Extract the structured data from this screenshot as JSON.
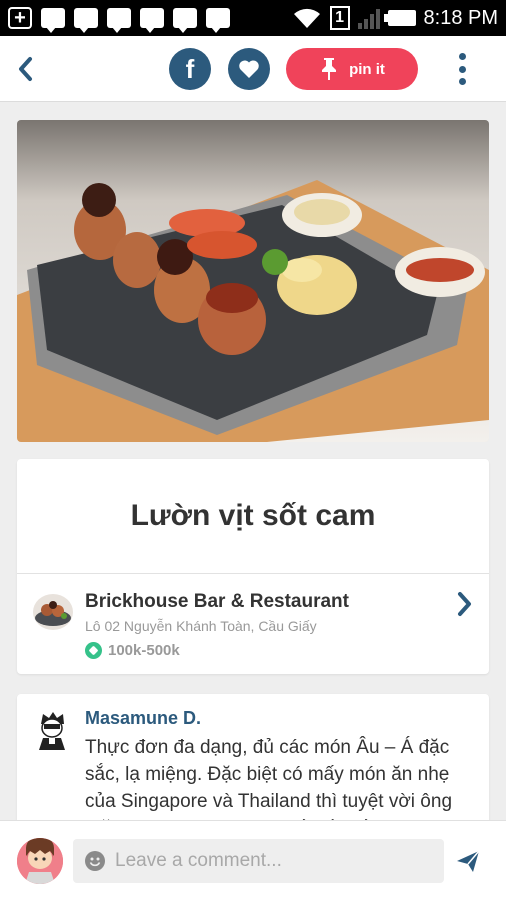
{
  "status_bar": {
    "time": "8:18 PM",
    "sim_label": "1"
  },
  "toolbar": {
    "pin_label": "pin it",
    "facebook_letter": "f"
  },
  "dish": {
    "name": "Lườn vịt sốt cam"
  },
  "venue": {
    "name": "Brickhouse Bar & Restaurant",
    "address": "Lô 02 Nguyễn Khánh Toàn, Cầu Giấy",
    "price_range": "100k-500k"
  },
  "review": {
    "author": "Masamune D.",
    "text": "Thực đơn đa dạng, đủ các món Âu – Á đặc sắc, lạ miệng. Đặc biệt có mấy món ăn nhẹ của Singapore và Thailand thì tuyệt vời ông mặt trời luôn! Ngó qua thấy đồ uống cũng"
  },
  "comment": {
    "placeholder": "Leave a comment..."
  },
  "colors": {
    "primary": "#2c5a7d",
    "pin": "#f0435a",
    "price_badge": "#35c28a"
  },
  "icons": [
    "back-icon",
    "facebook-icon",
    "heart-icon",
    "pin-icon",
    "more-vert-icon",
    "chevron-right-icon",
    "price-icon",
    "smiley-icon",
    "send-icon"
  ]
}
